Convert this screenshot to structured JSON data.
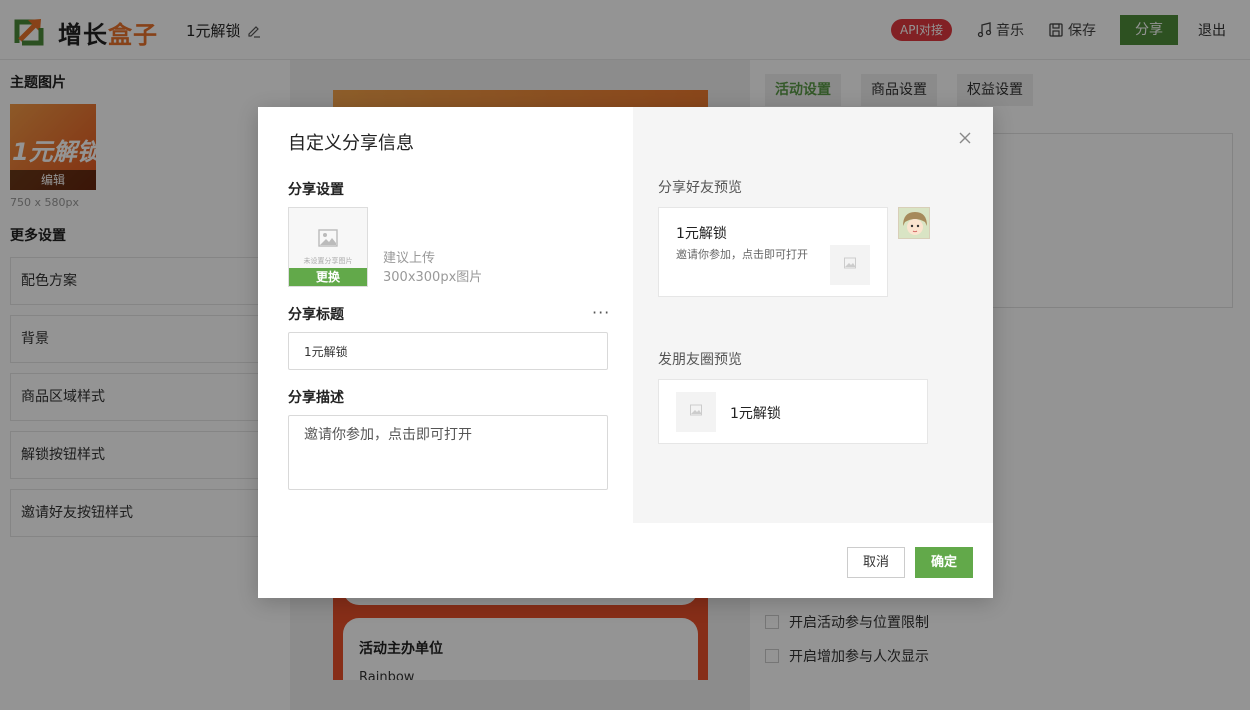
{
  "header": {
    "logo_part1": "增长",
    "logo_part2": "盒子",
    "doc_title": "1元解锁",
    "api_badge": "API对接",
    "music_label": "音乐",
    "save_label": "保存",
    "share_label": "分享",
    "exit_label": "退出"
  },
  "left": {
    "theme_title": "主题图片",
    "theme_thumb_text": "1元解锁",
    "theme_edit_label": "编辑",
    "thumb_size": "750 x 580px",
    "more_title": "更多设置",
    "items": [
      {
        "label": "配色方案"
      },
      {
        "label": "背景"
      },
      {
        "label": "商品区域样式"
      },
      {
        "label": "解锁按钮样式"
      },
      {
        "label": "邀请好友按钮样式"
      }
    ]
  },
  "preview": {
    "org_title": "活动主办单位",
    "org_name": "Rainbow"
  },
  "right": {
    "tabs": [
      {
        "label": "活动设置",
        "active": true
      },
      {
        "label": "商品设置",
        "active": false
      },
      {
        "label": "权益设置",
        "active": false
      }
    ],
    "checks": [
      {
        "label": "开启活动参与位置限制"
      },
      {
        "label": "开启增加参与人次显示"
      }
    ]
  },
  "modal": {
    "title": "自定义分享信息",
    "share_settings_label": "分享设置",
    "upload_placeholder": "未设置分享图片",
    "change_label": "更换",
    "upload_tip": "建议上传300x300px图片",
    "share_title_label": "分享标题",
    "more_icon": "more-dots-icon",
    "share_title_value": "1元解锁",
    "share_desc_label": "分享描述",
    "share_desc_value": "邀请你参加，点击即可打开",
    "friend_preview_label": "分享好友预览",
    "friend_card_title": "1元解锁",
    "friend_card_desc": "邀请你参加，点击即可打开",
    "moments_preview_label": "发朋友圈预览",
    "moments_card_title": "1元解锁",
    "cancel_label": "取消",
    "ok_label": "确定"
  },
  "colors": {
    "accent_green": "#62a94a",
    "share_green": "#4e8c3a",
    "api_red": "#e0383e",
    "brand_orange": "#e8732c"
  }
}
